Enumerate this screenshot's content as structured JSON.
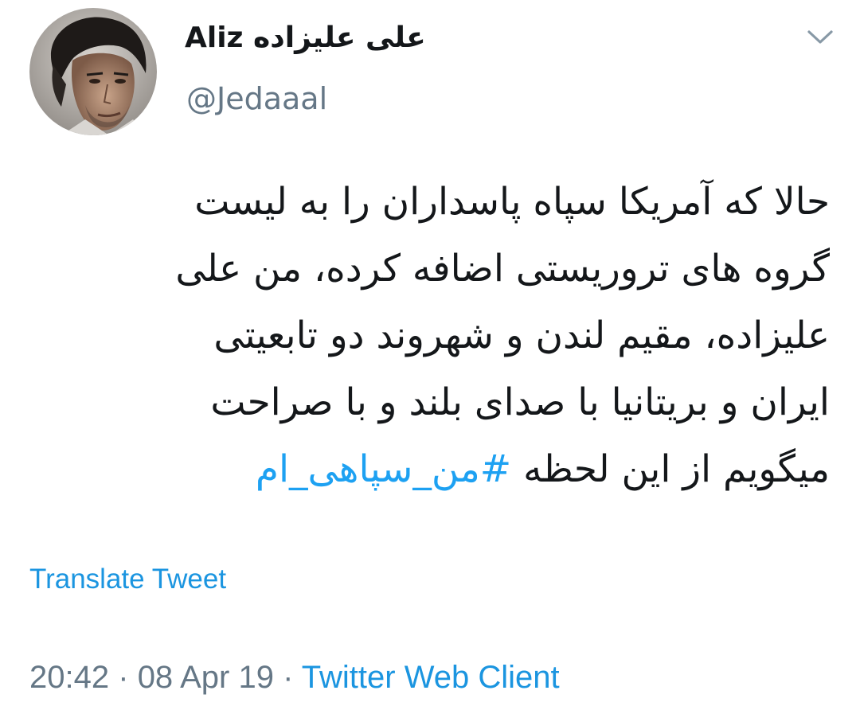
{
  "author": {
    "display_name": "Aliz علی علیزاده",
    "handle": "@Jedaaal",
    "avatar_icon": "profile-photo"
  },
  "header": {
    "caret_icon": "chevron-down-icon"
  },
  "tweet": {
    "lines": [
      "حالا که آمریکا سپاه پاسداران را به لیست",
      "گروه های تروریستی اضافه کرده، من علی",
      "علیزاده، مقیم لندن و شهروند دو تابعیتی",
      "ایران و بریتانیا با صدای بلند و با صراحت"
    ],
    "last_line_text": "میگویم از این لحظه",
    "hashtag": "#من_سپاهی_ام"
  },
  "actions": {
    "translate_label": "Translate Tweet"
  },
  "meta": {
    "time": "20:42",
    "separator1": "·",
    "date": "08 Apr 19",
    "separator2": "·",
    "client": "Twitter Web Client"
  },
  "colors": {
    "link": "#1b95e0",
    "hashtag": "#1da1f2",
    "secondary_text": "#657786",
    "primary_text": "#14171a"
  }
}
